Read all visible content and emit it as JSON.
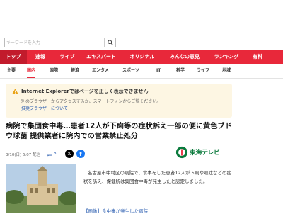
{
  "search": {
    "placeholder": "キーワードを入力",
    "search_icon": "magnifier-icon"
  },
  "main_nav": [
    {
      "label": "トップ",
      "active": true
    },
    {
      "label": "速報",
      "active": false
    },
    {
      "label": "ライブ",
      "active": false
    },
    {
      "label": "エキスパート",
      "active": false
    },
    {
      "label": "オリジナル",
      "active": false
    },
    {
      "label": "みんなの意見",
      "active": false
    },
    {
      "label": "ランキング",
      "active": false
    },
    {
      "label": "有料",
      "active": false
    }
  ],
  "sub_nav": [
    {
      "label": "主要",
      "active": false
    },
    {
      "label": "国内",
      "active": true
    },
    {
      "label": "国際",
      "active": false
    },
    {
      "label": "経済",
      "active": false
    },
    {
      "label": "エンタメ",
      "active": false
    },
    {
      "label": "スポーツ",
      "active": false
    },
    {
      "label": "IT",
      "active": false
    },
    {
      "label": "科学",
      "active": false
    },
    {
      "label": "ライフ",
      "active": false
    },
    {
      "label": "地域",
      "active": false
    }
  ],
  "notice": {
    "title": "Internet Explorerではページを正しく表示できません",
    "body": "別のブラウザーからアクセスするか、スマートフォンからご覧ください。",
    "link": "推奨ブラウザーについて",
    "icon": "warning-icon"
  },
  "article": {
    "headline": "病院で集団食中毒…患者12人が下痢等の症状訴え一部の便に黄色ブドウ球菌 提供業者に院内での営業禁止処分",
    "date": "3/10(日) 6:07 配信",
    "comment_count": "8",
    "publisher": "東海テレビ",
    "body": "名古屋市中村区の病院で、食事をした患者12人が下痢や嘔吐などの症状を訴え、保健所は集団食中毒が発生したと認定しました。",
    "link_text": "【画像】食中毒が発生した病院"
  },
  "colors": {
    "accent": "#e8283a",
    "accent_dark": "#c21b2c",
    "notice_bg": "#fdf6e3",
    "link": "#2a5db0",
    "publisher_green": "#0a7a3c"
  }
}
